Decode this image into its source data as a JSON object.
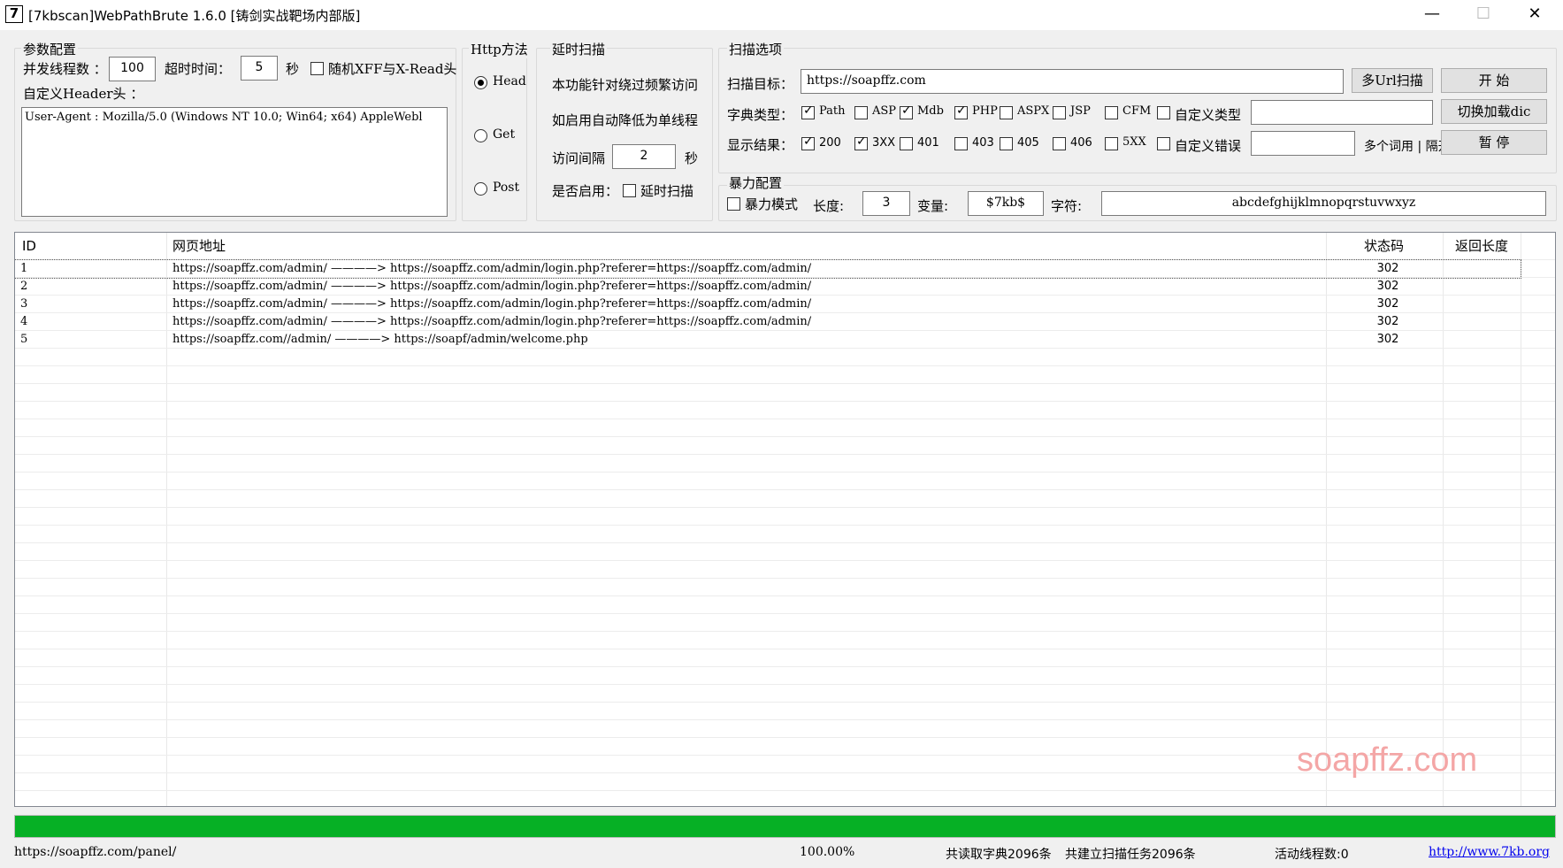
{
  "window": {
    "icon_glyph": "7",
    "title": "[7kbscan]WebPathBrute 1.6.0 [铸剑实战靶场内部版]",
    "minimize": "—",
    "maximize": "☐",
    "close": "✕"
  },
  "params": {
    "group_title": "参数配置",
    "threads_label": "并发线程数 ：",
    "threads_value": "100",
    "timeout_label": "超时时间：",
    "timeout_value": "5",
    "timeout_unit": "秒",
    "random_xff_label": "随机XFF与X-Read头",
    "random_xff_checked": false,
    "header_label": "自定义Header头 ：",
    "header_value": "User-Agent : Mozilla/5.0 (Windows NT 10.0; Win64; x64) AppleWebl"
  },
  "http_method": {
    "group_title": "Http方法",
    "options": [
      "Head",
      "Get",
      "Post"
    ],
    "selected": "Head"
  },
  "delay": {
    "group_title": "延时扫描",
    "desc1": "本功能针对绕过频繁访问",
    "desc2": "如启用自动降低为单线程",
    "interval_label": "访问间隔",
    "interval_value": "2",
    "interval_unit": "秒",
    "enable_label": "是否启用：",
    "enable_checkbox_label": "延时扫描",
    "enabled": false
  },
  "scan": {
    "group_title": "扫描选项",
    "target_label": "扫描目标：",
    "target_value": "https://soapffz.com",
    "multi_url_button": "多Url扫描",
    "start_button": "开 始",
    "dict_label": "字典类型：",
    "dict_types": [
      {
        "label": "Path",
        "checked": true
      },
      {
        "label": "ASP",
        "checked": false
      },
      {
        "label": "Mdb",
        "checked": true
      },
      {
        "label": "PHP",
        "checked": true
      },
      {
        "label": "ASPX",
        "checked": false
      },
      {
        "label": "JSP",
        "checked": false
      },
      {
        "label": "CFM",
        "checked": false
      },
      {
        "label": "自定义类型",
        "checked": false
      }
    ],
    "custom_type_value": "",
    "switch_dict_button": "切换加载dic",
    "result_label": "显示结果：",
    "result_codes": [
      {
        "label": "200",
        "checked": true
      },
      {
        "label": "3XX",
        "checked": true
      },
      {
        "label": "401",
        "checked": false
      },
      {
        "label": "403",
        "checked": false
      },
      {
        "label": "405",
        "checked": false
      },
      {
        "label": "406",
        "checked": false
      },
      {
        "label": "5XX",
        "checked": false
      },
      {
        "label": "自定义错误",
        "checked": false
      }
    ],
    "custom_error_value": "",
    "multi_word_hint": "多个词用 | 隔开",
    "pause_button": "暂 停"
  },
  "brute": {
    "group_title": "暴力配置",
    "mode_label": "暴力模式",
    "mode_checked": false,
    "length_label": "长度:",
    "length_value": "3",
    "variable_label": "变量:",
    "variable_value": "$7kb$",
    "charset_label": "字符:",
    "charset_value": "abcdefghijklmnopqrstuvwxyz"
  },
  "results": {
    "columns": [
      "ID",
      "网页地址",
      "状态码",
      "返回长度"
    ],
    "rows": [
      {
        "id": "1",
        "url": "https://soapffz.com/admin/  ————> https://soapffz.com/admin/login.php?referer=https://soapffz.com/admin/",
        "status": "302",
        "length": ""
      },
      {
        "id": "2",
        "url": "https://soapffz.com/admin/  ————> https://soapffz.com/admin/login.php?referer=https://soapffz.com/admin/",
        "status": "302",
        "length": ""
      },
      {
        "id": "3",
        "url": "https://soapffz.com/admin/  ————> https://soapffz.com/admin/login.php?referer=https://soapffz.com/admin/",
        "status": "302",
        "length": ""
      },
      {
        "id": "4",
        "url": "https://soapffz.com/admin/  ————> https://soapffz.com/admin/login.php?referer=https://soapffz.com/admin/",
        "status": "302",
        "length": ""
      },
      {
        "id": "5",
        "url": "https://soapffz.com//admin/  ————> https://soapf/admin/welcome.php",
        "status": "302",
        "length": ""
      }
    ]
  },
  "progress": {
    "fraction": 1.0
  },
  "statusbar": {
    "current_url": "https://soapffz.com/panel/",
    "percent": "100.00%",
    "dict_read": "共读取字典2096条",
    "tasks": "共建立扫描任务2096条",
    "active_threads": "活动线程数:0",
    "link": "http://www.7kb.org"
  },
  "watermark": "soapffz.com",
  "colors": {
    "progress": "#06b025",
    "link": "#0000ee",
    "watermark": "#f4a6a6"
  }
}
